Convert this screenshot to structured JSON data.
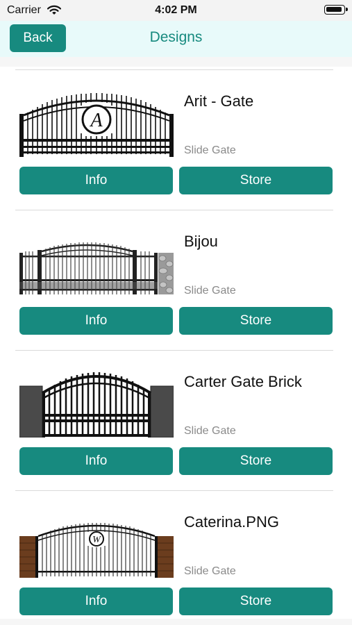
{
  "status_bar": {
    "carrier": "Carrier",
    "time": "4:02 PM"
  },
  "nav": {
    "back_label": "Back",
    "title": "Designs"
  },
  "colors": {
    "accent": "#178a7f",
    "nav_background": "#e8fafa",
    "subtitle": "#8a8a8a"
  },
  "designs": [
    {
      "name": "Arit - Gate",
      "type": "Slide Gate",
      "info_label": "Info",
      "store_label": "Store",
      "monogram": "A"
    },
    {
      "name": "Bijou",
      "type": "Slide Gate",
      "info_label": "Info",
      "store_label": "Store"
    },
    {
      "name": "Carter Gate Brick",
      "type": "Slide Gate",
      "info_label": "Info",
      "store_label": "Store"
    },
    {
      "name": "Caterina.PNG",
      "type": "Slide Gate",
      "info_label": "Info",
      "store_label": "Store",
      "monogram": "W"
    }
  ]
}
